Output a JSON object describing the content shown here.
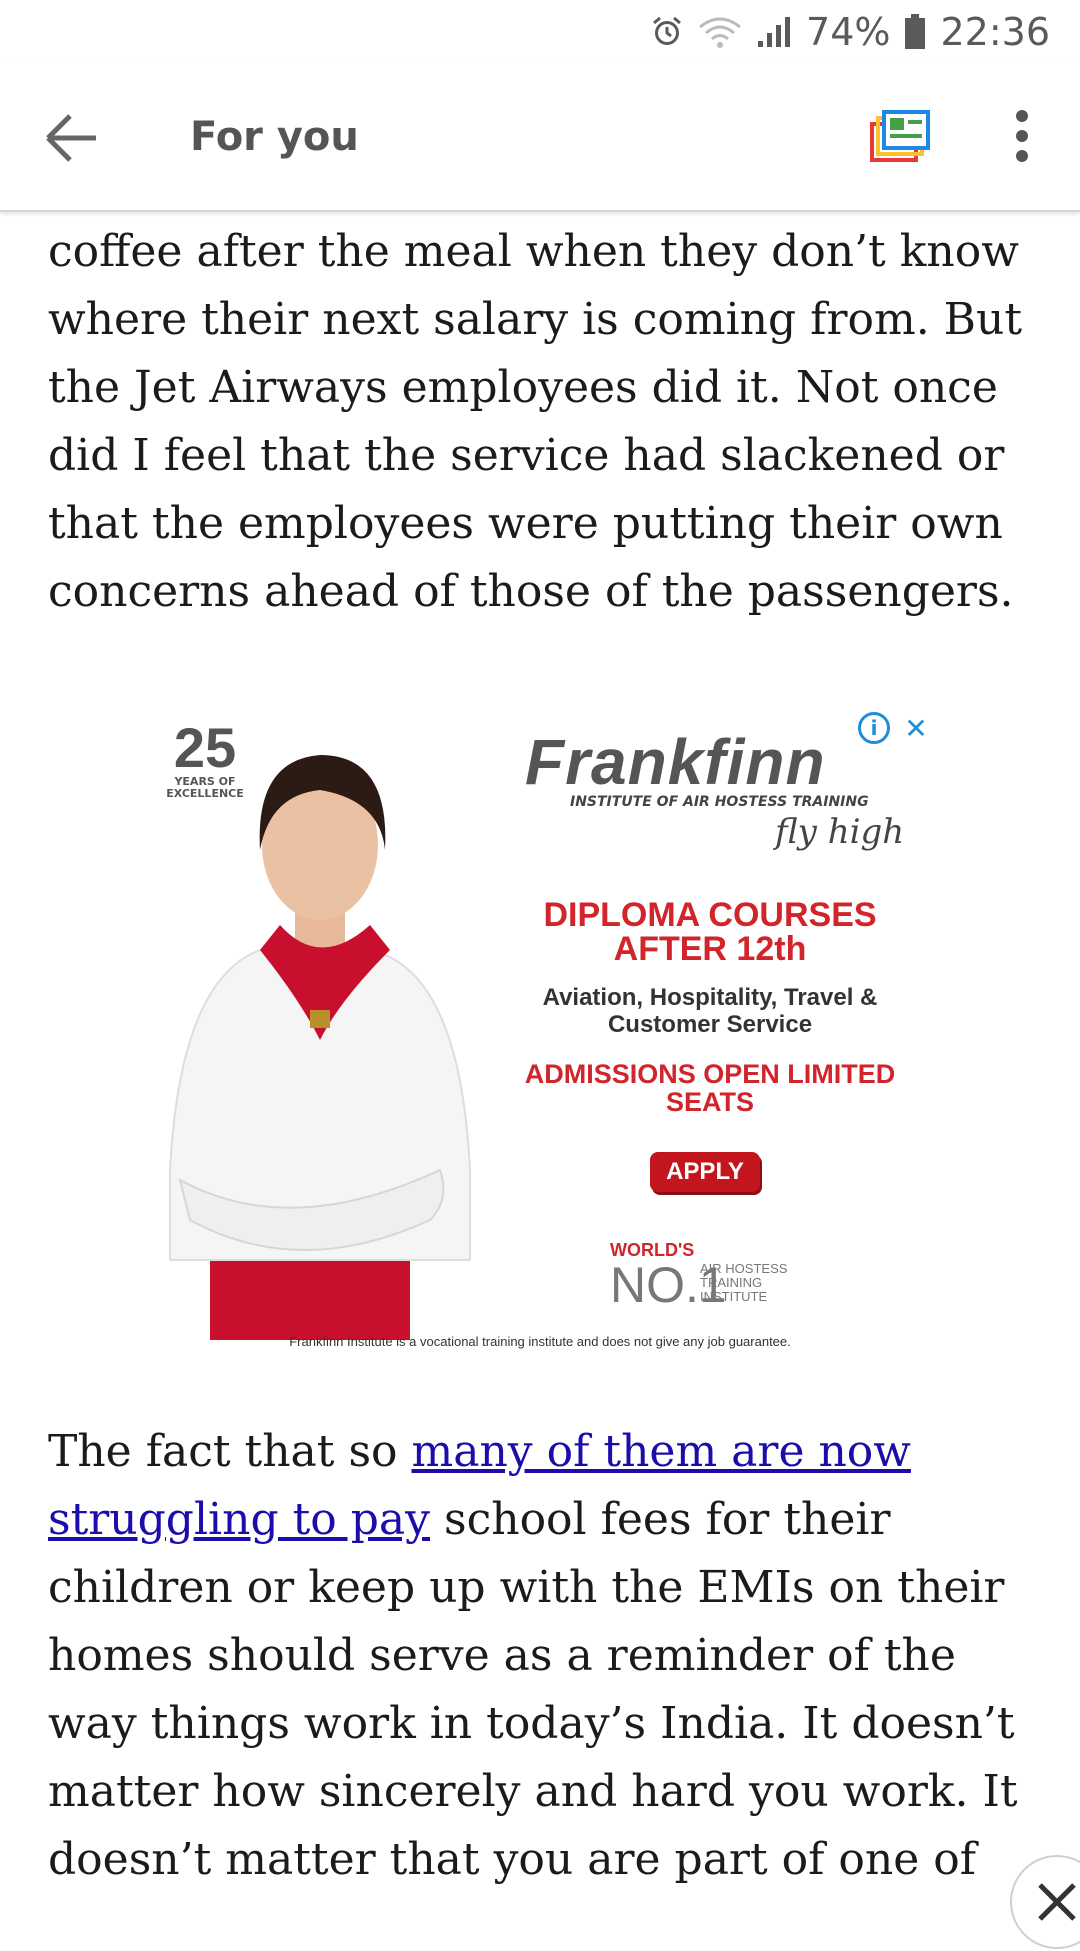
{
  "status": {
    "battery": "74%",
    "time": "22:36"
  },
  "appbar": {
    "title": "For you"
  },
  "article": {
    "p1": "coffee after the meal when they don’t know where their next salary is coming from. But the Jet Airways employees did it. Not once did I feel that the service had slackened or that the employees were putting their own concerns ahead of those of the passengers.",
    "p2_before": "The fact that so ",
    "p2_link": "many of them are now struggling to pay",
    "p2_after": " school fees for their children or keep up with the EMIs on their homes should serve as a reminder of the way things work in today’s India. It doesn’t matter how sincerely and hard you work. It doesn’t matter that you are part of one of"
  },
  "ad": {
    "anniv_num": "25",
    "anniv_sub": "YEARS OF EXCELLENCE",
    "brand": "Frankfinn",
    "brand_sub": "INSTITUTE OF AIR HOSTESS TRAINING",
    "tagline": "fly high",
    "diploma": "DIPLOMA COURSES AFTER 12th",
    "subjects": "Aviation, Hospitality, Travel & Customer Service",
    "admissions": "ADMISSIONS OPEN LIMITED SEATS",
    "apply": "APPLY",
    "worlds": "WORLD'S",
    "no1": "NO.1",
    "no1_sub": "AIR HOSTESS TRAINING INSTITUTE",
    "disclaimer": "Frankfinn Institute is a vocational training institute and does not give any job guarantee.",
    "info_icon": "i",
    "close_icon": "✕"
  },
  "icons": {
    "back": "back-arrow-icon",
    "news": "news-icon",
    "menu": "more-vert-icon",
    "close": "close-icon"
  },
  "colors": {
    "link": "#1a0dab",
    "ad_red": "#d1242b",
    "ad_info_blue": "#1e8fd6"
  }
}
